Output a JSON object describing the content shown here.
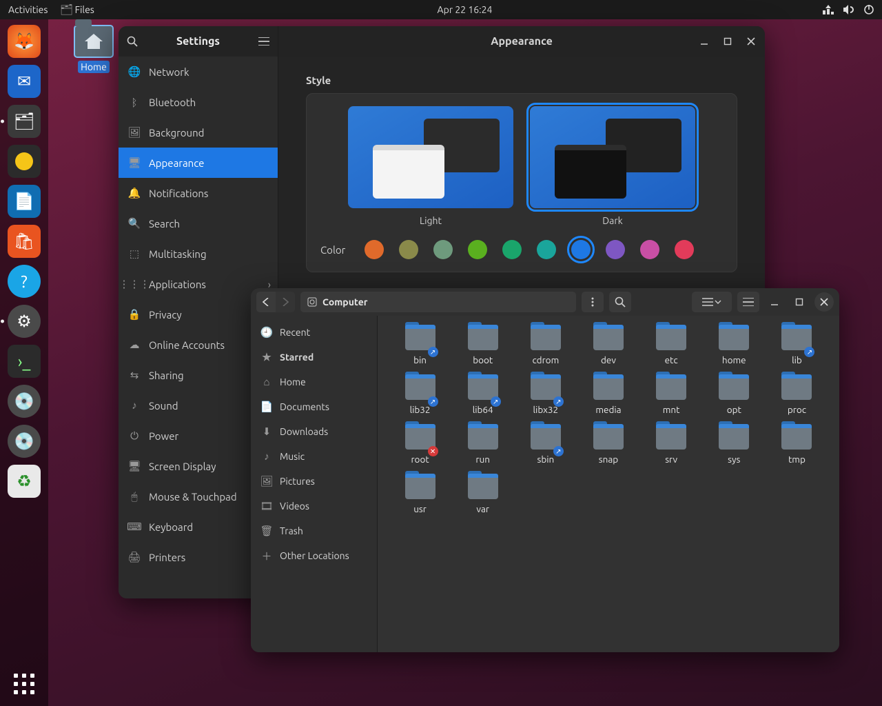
{
  "topbar": {
    "activities": "Activities",
    "app_menu": "Files",
    "clock": "Apr 22  16:24"
  },
  "desktop": {
    "home_label": "Home"
  },
  "settings": {
    "title": "Settings",
    "content_title": "Appearance",
    "sidebar": [
      "Network",
      "Bluetooth",
      "Background",
      "Appearance",
      "Notifications",
      "Search",
      "Multitasking",
      "Applications",
      "Privacy",
      "Online Accounts",
      "Sharing",
      "Sound",
      "Power",
      "Screen Display",
      "Mouse & Touchpad",
      "Keyboard",
      "Printers"
    ],
    "selected_sidebar": "Appearance",
    "style_heading": "Style",
    "themes": {
      "light": "Light",
      "dark": "Dark",
      "selected": "Dark"
    },
    "color_label": "Color",
    "colors": [
      "#e06a2b",
      "#8a8a4a",
      "#6e9a7d",
      "#5ab01f",
      "#1aa56b",
      "#1aa59b",
      "#1e78e4",
      "#7e57c2",
      "#c94fa5",
      "#e23b5a"
    ],
    "selected_color_index": 6
  },
  "files": {
    "path_label": "Computer",
    "places": [
      "Recent",
      "Starred",
      "Home",
      "Documents",
      "Downloads",
      "Music",
      "Pictures",
      "Videos",
      "Trash",
      "Other Locations"
    ],
    "selected_place": "Starred",
    "items": [
      {
        "name": "bin",
        "badge": "link"
      },
      {
        "name": "boot"
      },
      {
        "name": "cdrom"
      },
      {
        "name": "dev"
      },
      {
        "name": "etc"
      },
      {
        "name": "home"
      },
      {
        "name": "lib",
        "badge": "link"
      },
      {
        "name": "lib32",
        "badge": "link"
      },
      {
        "name": "lib64",
        "badge": "link"
      },
      {
        "name": "libx32",
        "badge": "link"
      },
      {
        "name": "media"
      },
      {
        "name": "mnt"
      },
      {
        "name": "opt"
      },
      {
        "name": "proc"
      },
      {
        "name": "root",
        "badge": "deny"
      },
      {
        "name": "run"
      },
      {
        "name": "sbin",
        "badge": "link"
      },
      {
        "name": "snap"
      },
      {
        "name": "srv"
      },
      {
        "name": "sys"
      },
      {
        "name": "tmp"
      },
      {
        "name": "usr"
      },
      {
        "name": "var"
      }
    ]
  }
}
